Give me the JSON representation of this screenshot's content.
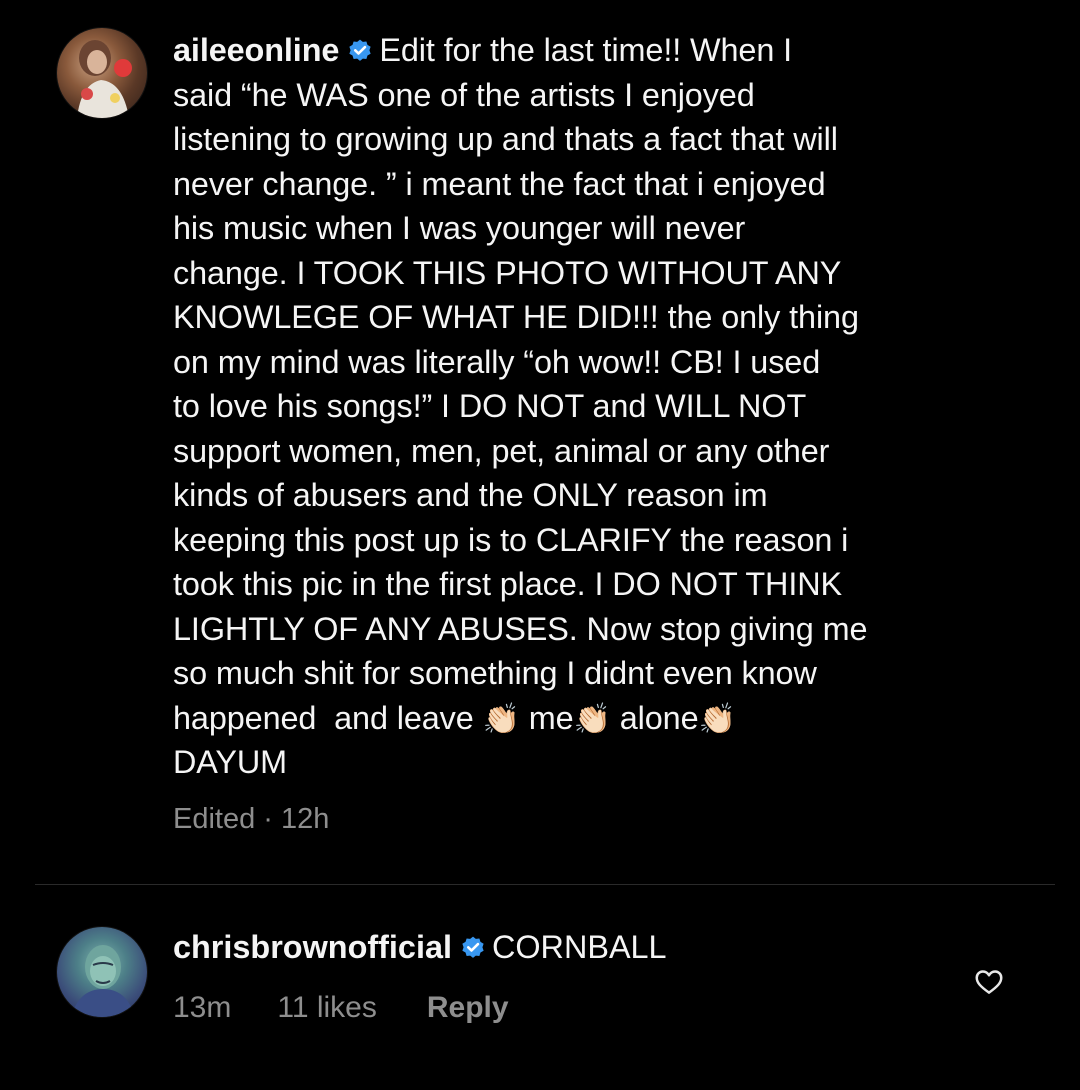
{
  "comments": [
    {
      "username": "aileeonline",
      "verified": true,
      "text_lines": [
        "Edit for the last time!! When I",
        "said “he WAS one of the artists I enjoyed",
        "listening to growing up and thats a fact that will",
        "never change. ” i meant the fact that i enjoyed",
        "his music when I was younger will never",
        "change. I TOOK THIS PHOTO WITHOUT ANY",
        "KNOWLEGE OF WHAT HE DID!!! the only thing",
        "on my mind was literally “oh wow!! CB! I used",
        "to love his songs!” I DO NOT and WILL NOT",
        "support women, men, pet, animal or any other",
        "kinds of abusers and the ONLY reason im",
        "keeping this post up is to CLARIFY the reason i",
        "took this pic in the first place. I DO NOT THINK",
        "LIGHTLY OF ANY ABUSES. Now stop giving me",
        "so much shit for something I didnt even know"
      ],
      "line_16": {
        "part1": "happened  and leave ",
        "part2": " me",
        "part3": " alone"
      },
      "last_line": "DAYUM",
      "clap_emoji": "👏🏻",
      "meta": "Edited · 12h"
    },
    {
      "username": "chrisbrownofficial",
      "verified": true,
      "text": "CORNBALL",
      "time": "13m",
      "likes": "11 likes",
      "reply": "Reply"
    }
  ],
  "colors": {
    "background": "#000000",
    "text": "#f5f5f5",
    "secondary": "#8e8e8e",
    "verified_badge": "#3897f0"
  },
  "icons": {
    "verified": "verified-badge-icon",
    "like": "heart-icon"
  }
}
